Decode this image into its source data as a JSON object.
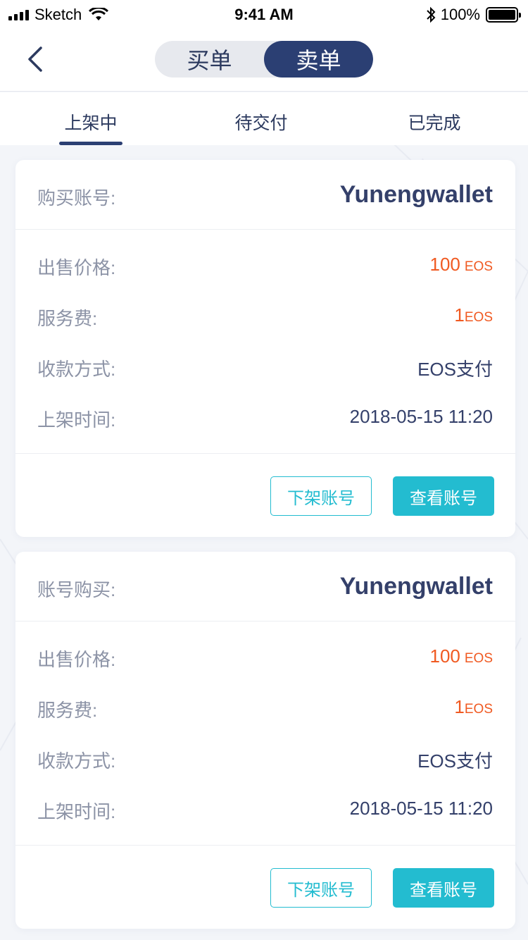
{
  "status_bar": {
    "carrier": "Sketch",
    "time": "9:41 AM",
    "battery": "100%"
  },
  "nav": {
    "segments": [
      "买单",
      "卖单"
    ],
    "active_segment": 1
  },
  "tabs": [
    "上架中",
    "待交付",
    "已完成"
  ],
  "active_tab": 0,
  "orders": [
    {
      "header_label": "购买账号:",
      "account": "Yunengwallet",
      "price_label": "出售价格:",
      "price": "100",
      "price_unit": "EOS",
      "fee_label": "服务费:",
      "fee": "1",
      "fee_unit": "EOS",
      "payment_label": "收款方式:",
      "payment": "EOS支付",
      "time_label": "上架时间:",
      "time": "2018-05-15 11:20",
      "delist_label": "下架账号",
      "view_label": "查看账号"
    },
    {
      "header_label": "账号购买:",
      "account": "Yunengwallet",
      "price_label": "出售价格:",
      "price": "100",
      "price_unit": "EOS",
      "fee_label": "服务费:",
      "fee": "1",
      "fee_unit": "EOS",
      "payment_label": "收款方式:",
      "payment": "EOS支付",
      "time_label": "上架时间:",
      "time": "2018-05-15 11:20",
      "delist_label": "下架账号",
      "view_label": "查看账号"
    }
  ],
  "colors": {
    "primary": "#2b3f73",
    "accent": "#23bcd0",
    "price": "#f05a22"
  }
}
